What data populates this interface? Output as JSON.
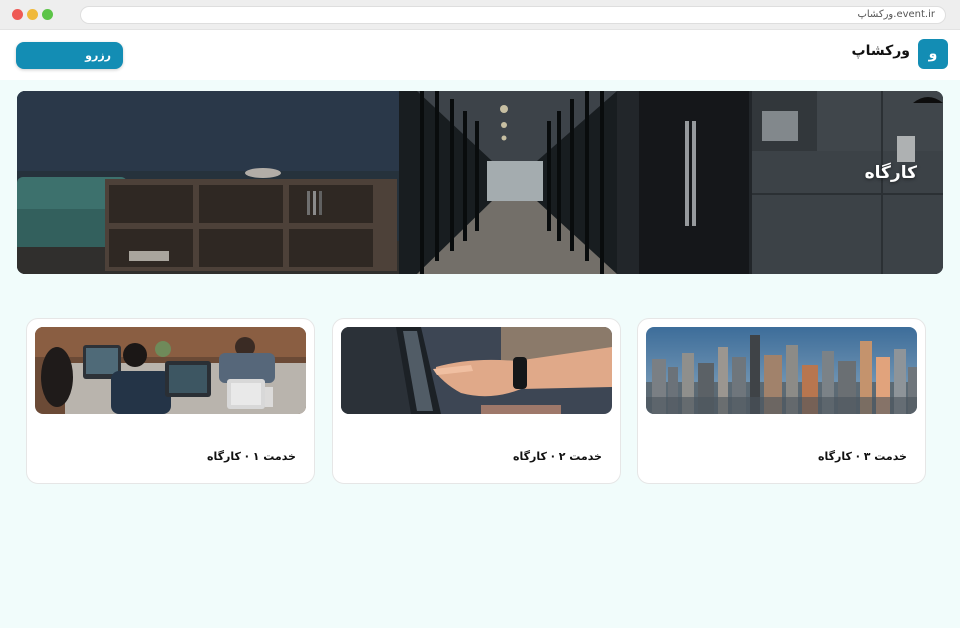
{
  "browser": {
    "url": "ورکشاپ.event.ir"
  },
  "header": {
    "logo_letter": "و",
    "brand_name": "ورکشاپ",
    "reserve_label": "رزرو"
  },
  "hero": {
    "title": "کارگاه"
  },
  "cards": [
    {
      "title": "خدمت ۳ · کارگاه",
      "image": "city-skyline-image"
    },
    {
      "title": "خدمت ۲ · کارگاه",
      "image": "hand-pointing-laptop-image"
    },
    {
      "title": "خدمت ۱ · کارگاه",
      "image": "people-with-laptops-image"
    }
  ],
  "colors": {
    "accent": "#138db4",
    "page_background": "#f1fcfb"
  }
}
